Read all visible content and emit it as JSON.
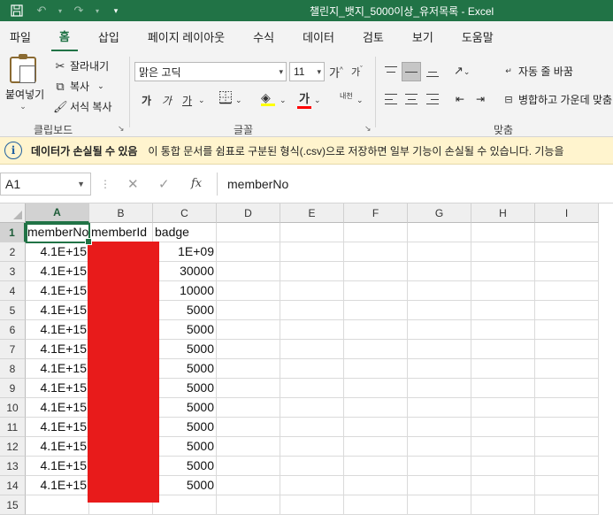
{
  "window": {
    "title": "챌린지_뱃지_5000이상_유저목록  -  Excel"
  },
  "quick_access": {
    "save_icon": "save-icon",
    "undo_icon": "undo-icon",
    "redo_icon": "redo-icon",
    "customize_icon": "chevron-down-icon"
  },
  "tabs": [
    "파일",
    "홈",
    "삽입",
    "페이지 레이아웃",
    "수식",
    "데이터",
    "검토",
    "보기",
    "도움말"
  ],
  "active_tab": "홈",
  "ribbon": {
    "clipboard": {
      "paste_label": "붙여넣기",
      "cut_label": "잘라내기",
      "copy_label": "복사",
      "format_painter_label": "서식 복사",
      "group_label": "클립보드"
    },
    "font": {
      "font_name": "맑은 고딕",
      "font_size": "11",
      "grow_label": "가",
      "shrink_label": "가",
      "bold_label": "가",
      "italic_label": "가",
      "underline_label": "가",
      "font_color_label": "가",
      "phonetic_label": "내천",
      "group_label": "글꼴",
      "fill_color": "#ffff00",
      "font_color": "#ff0000"
    },
    "alignment": {
      "wrap_text_label": "자동 줄 바꿈",
      "merge_label": "병합하고 가운데 맞춤",
      "group_label": "맞춤"
    }
  },
  "infobar": {
    "title": "데이터가 손실될 수 있음",
    "message": "이 통합 문서를 쉼표로 구분된 형식(.csv)으로 저장하면 일부 기능이 손실될 수 있습니다. 기능을"
  },
  "formula_bar": {
    "name_box": "A1",
    "cancel": "✕",
    "enter": "✓",
    "fx": "fx",
    "value": "memberNo"
  },
  "sheet": {
    "columns": [
      "A",
      "B",
      "C",
      "D",
      "E",
      "F",
      "G",
      "H",
      "I"
    ],
    "rows": [
      "1",
      "2",
      "3",
      "4",
      "5",
      "6",
      "7",
      "8",
      "9",
      "10",
      "11",
      "12",
      "13",
      "14",
      "15"
    ],
    "header": {
      "A": "memberNo",
      "B": "memberId",
      "C": "badge"
    },
    "data": [
      {
        "A": "4.1E+15",
        "C": "1E+09"
      },
      {
        "A": "4.1E+15",
        "C": "30000"
      },
      {
        "A": "4.1E+15",
        "C": "10000"
      },
      {
        "A": "4.1E+15",
        "C": "5000"
      },
      {
        "A": "4.1E+15",
        "C": "5000"
      },
      {
        "A": "4.1E+15",
        "C": "5000"
      },
      {
        "A": "4.1E+15",
        "C": "5000"
      },
      {
        "A": "4.1E+15",
        "C": "5000"
      },
      {
        "A": "4.1E+15",
        "C": "5000"
      },
      {
        "A": "4.1E+15",
        "C": "5000"
      },
      {
        "A": "4.1E+15",
        "C": "5000"
      },
      {
        "A": "4.1E+15",
        "C": "5000"
      },
      {
        "A": "4.1E+15",
        "C": "5000"
      }
    ],
    "selected_cell": "A1",
    "redaction_color": "#e81b1b"
  }
}
